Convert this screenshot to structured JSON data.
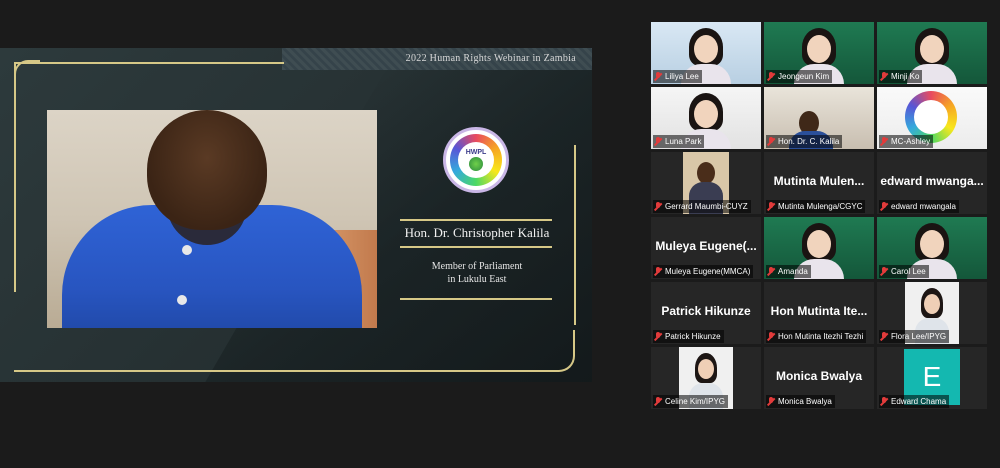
{
  "share": {
    "banner_title": "2022 Human Rights Webinar in Zambia",
    "logo_text": "HWPL",
    "speaker_name": "Hon. Dr. Christopher Kalila",
    "speaker_role_line1": "Member of Parliament",
    "speaker_role_line2": "in Lukulu East"
  },
  "participants": [
    {
      "label": "Liliya Lee",
      "video": true,
      "scene": "light"
    },
    {
      "label": "Jeongeun Kim",
      "video": true,
      "scene": "green"
    },
    {
      "label": "Minji Ko",
      "video": true,
      "scene": "green"
    },
    {
      "label": "Luna Park",
      "video": true,
      "scene": "white"
    },
    {
      "label": "Hon. Dr. C. Kalila",
      "video": true,
      "scene": "room"
    },
    {
      "label": "MC-Ashley",
      "video": true,
      "scene": "logo",
      "active": true
    },
    {
      "label": "Gerrard Maumbi-CUYZ",
      "video": true,
      "scene": "person-dark"
    },
    {
      "label": "Mutinta Mulenga/CGYC",
      "big_name": "Mutinta Mulen...",
      "video": false
    },
    {
      "label": "edward mwangala",
      "big_name": "edward mwanga...",
      "video": false
    },
    {
      "label": "Muleya Eugene(MMCA)",
      "big_name": "Muleya Eugene(...",
      "video": false
    },
    {
      "label": "Amanda",
      "video": true,
      "scene": "green"
    },
    {
      "label": "Carol Lee",
      "video": true,
      "scene": "green"
    },
    {
      "label": "Patrick Hikunze",
      "big_name": "Patrick Hikunze",
      "video": false
    },
    {
      "label": "Hon Mutinta Itezhi Tezhi",
      "big_name": "Hon Mutinta Ite...",
      "video": false
    },
    {
      "label": "Flora Lee/IPYG",
      "video": true,
      "scene": "white-small"
    },
    {
      "label": "Celine Kim/IPYG",
      "video": true,
      "scene": "white-small"
    },
    {
      "label": "Monica Bwalya",
      "big_name": "Monica Bwalya",
      "video": false
    },
    {
      "label": "Edward Chama",
      "avatar_letter": "E",
      "video": false
    }
  ]
}
